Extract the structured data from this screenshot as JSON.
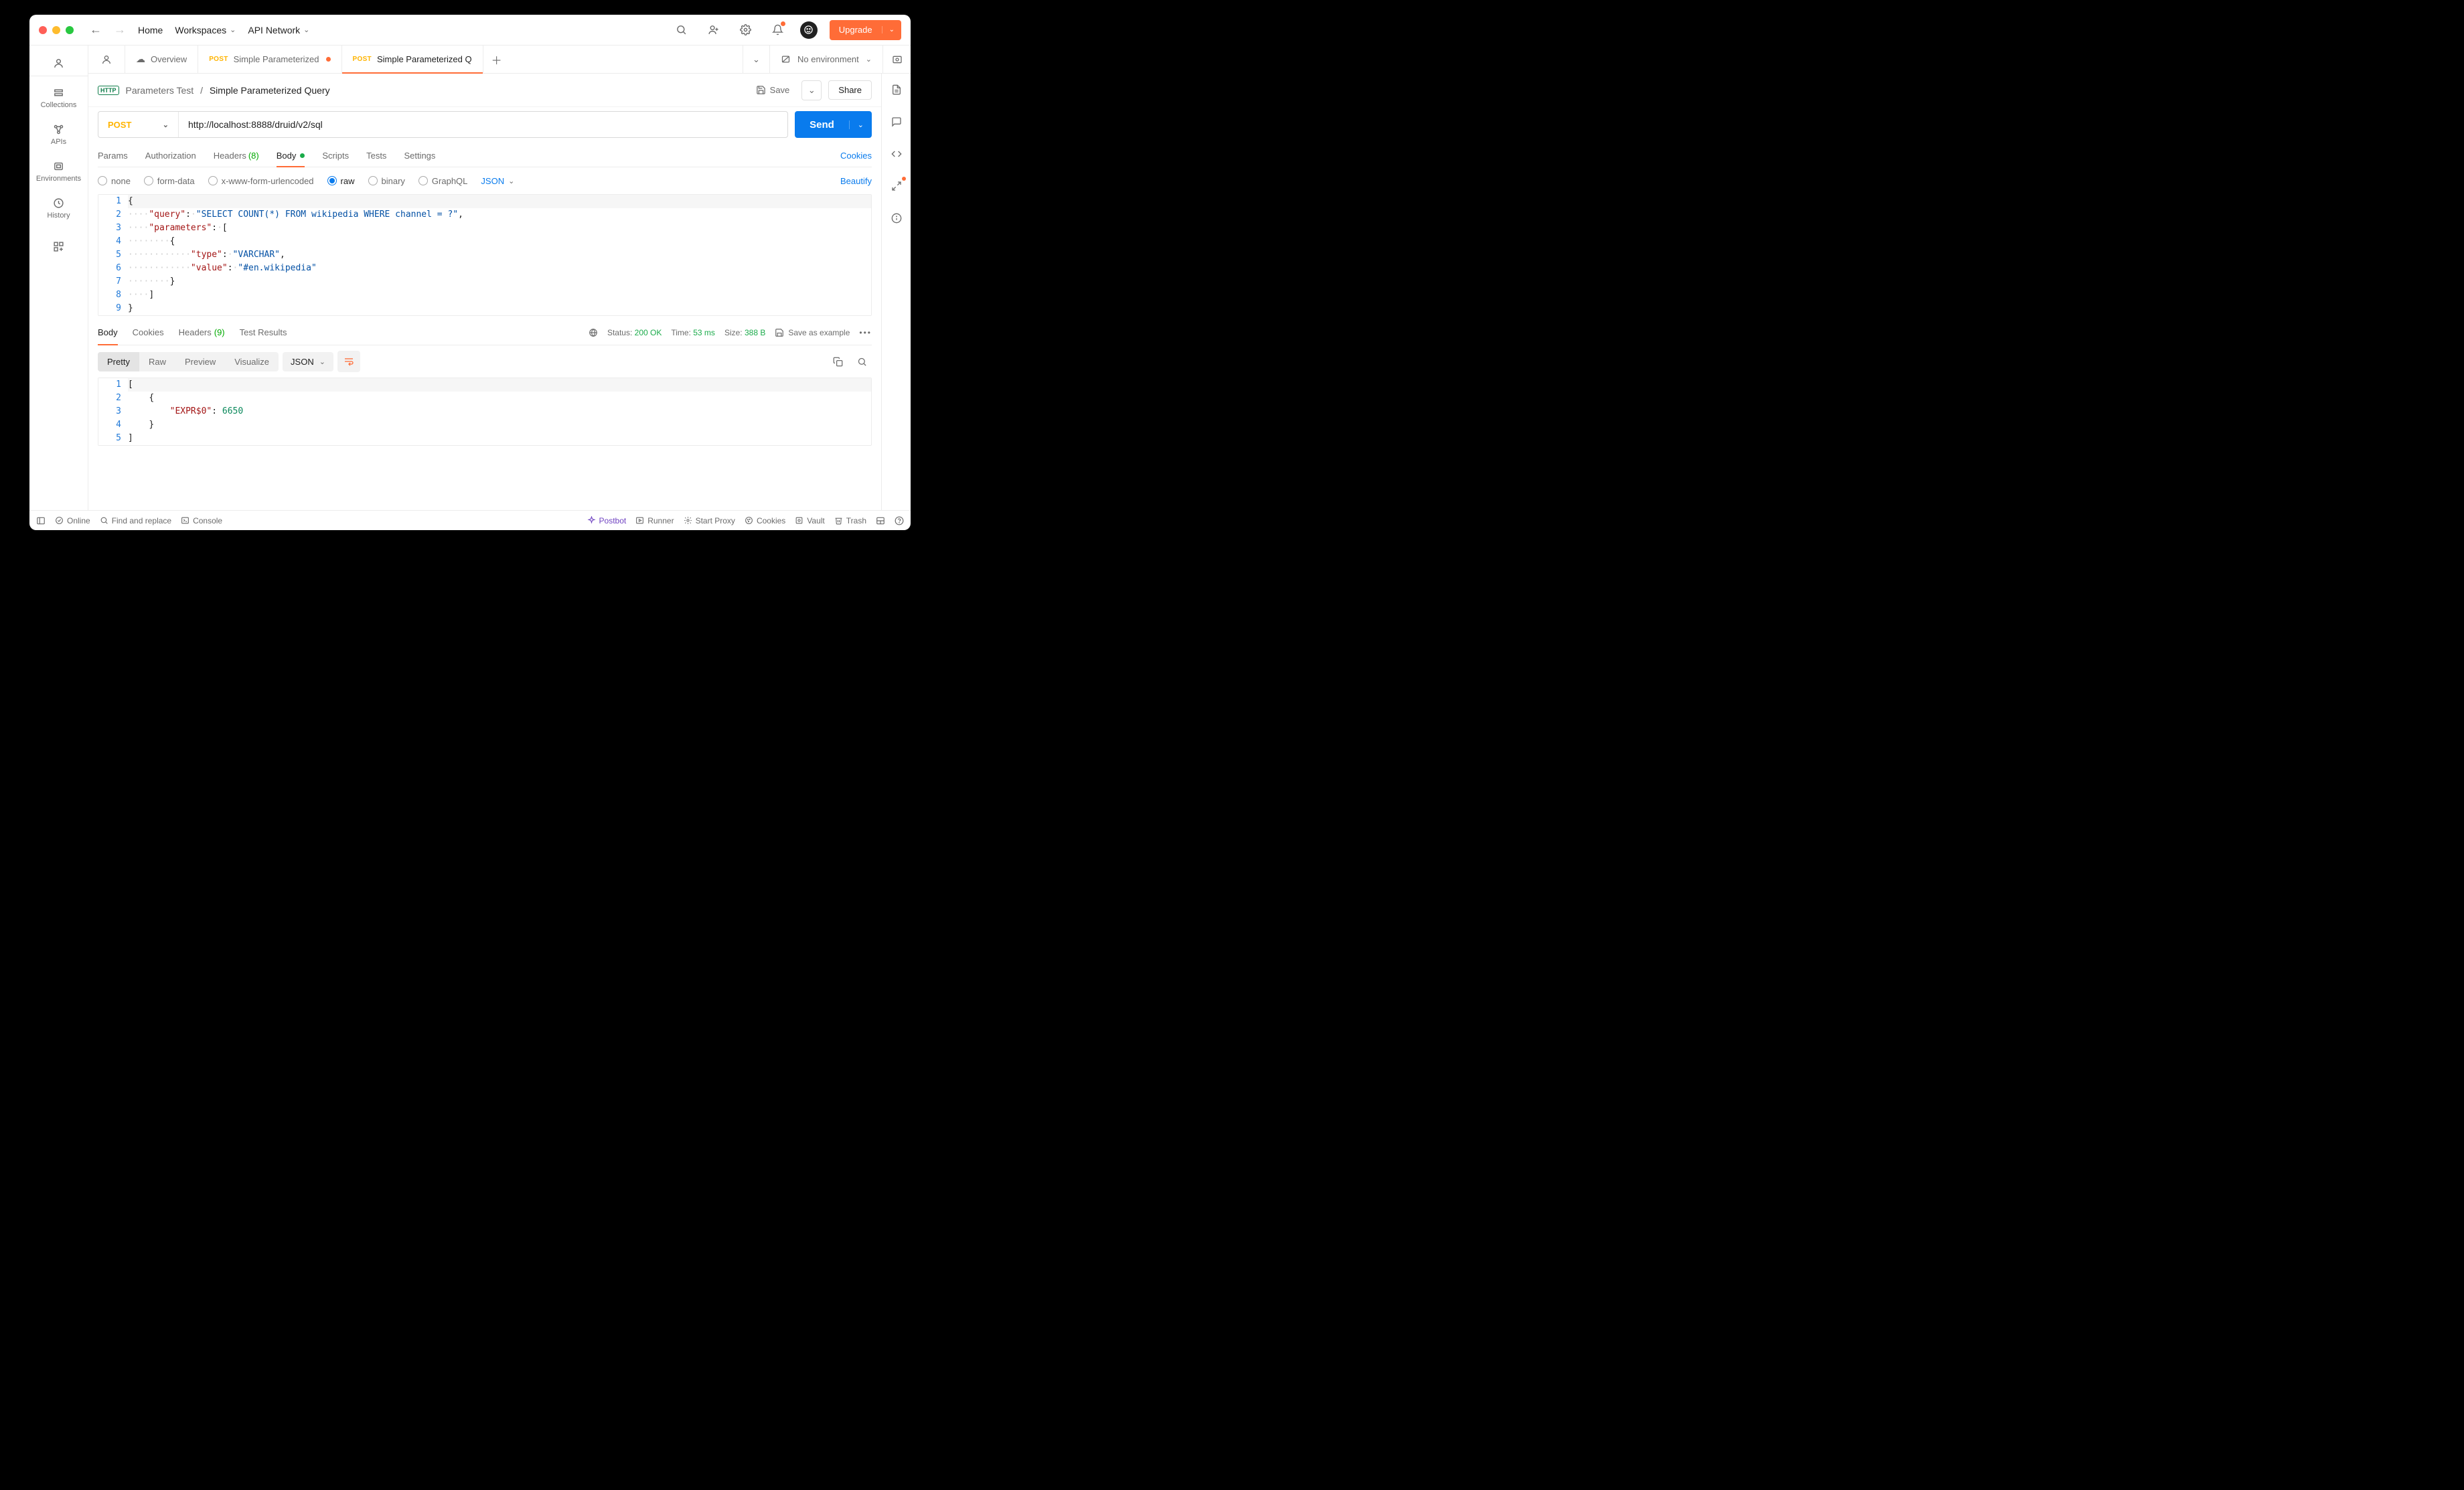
{
  "topbar": {
    "home": "Home",
    "workspaces": "Workspaces",
    "api_network": "API Network",
    "upgrade": "Upgrade"
  },
  "leftnav": {
    "collections": "Collections",
    "apis": "APIs",
    "environments": "Environments",
    "history": "History"
  },
  "tabs": {
    "overview": "Overview",
    "t1_method": "POST",
    "t1_label": "Simple Parameterized",
    "t2_method": "POST",
    "t2_label": "Simple Parameterized Q",
    "env_label": "No environment"
  },
  "crumb": {
    "http": "HTTP",
    "collection": "Parameters Test",
    "leaf": "Simple Parameterized Query",
    "save": "Save",
    "share": "Share"
  },
  "request": {
    "method": "POST",
    "url": "http://localhost:8888/druid/v2/sql",
    "send": "Send"
  },
  "req_tabs": {
    "params": "Params",
    "auth": "Authorization",
    "headers": "Headers",
    "headers_count": "(8)",
    "body": "Body",
    "scripts": "Scripts",
    "tests": "Tests",
    "settings": "Settings",
    "cookies": "Cookies"
  },
  "body_row": {
    "none": "none",
    "formdata": "form-data",
    "urlenc": "x-www-form-urlencoded",
    "raw": "raw",
    "binary": "binary",
    "graphql": "GraphQL",
    "json": "JSON",
    "beautify": "Beautify"
  },
  "editor": {
    "lines": [
      "1",
      "2",
      "3",
      "4",
      "5",
      "6",
      "7",
      "8",
      "9"
    ],
    "query_key": "\"query\"",
    "query_val": "\"SELECT COUNT(*) FROM wikipedia WHERE channel = ?\"",
    "params_key": "\"parameters\"",
    "type_key": "\"type\"",
    "type_val": "\"VARCHAR\"",
    "value_key": "\"value\"",
    "value_val": "\"#en.wikipedia\""
  },
  "resp_tabs": {
    "body": "Body",
    "cookies": "Cookies",
    "headers": "Headers",
    "headers_count": "(9)",
    "test": "Test Results",
    "status_lbl": "Status:",
    "status_val": "200 OK",
    "time_lbl": "Time:",
    "time_val": "53 ms",
    "size_lbl": "Size:",
    "size_val": "388 B",
    "save_example": "Save as example"
  },
  "resp_ctrl": {
    "pretty": "Pretty",
    "raw": "Raw",
    "preview": "Preview",
    "visualize": "Visualize",
    "json": "JSON"
  },
  "resp_editor": {
    "lines": [
      "1",
      "2",
      "3",
      "4",
      "5"
    ],
    "key": "\"EXPR$0\"",
    "val": "6650"
  },
  "statusbar": {
    "online": "Online",
    "find": "Find and replace",
    "console": "Console",
    "postbot": "Postbot",
    "runner": "Runner",
    "proxy": "Start Proxy",
    "cookies": "Cookies",
    "vault": "Vault",
    "trash": "Trash"
  }
}
